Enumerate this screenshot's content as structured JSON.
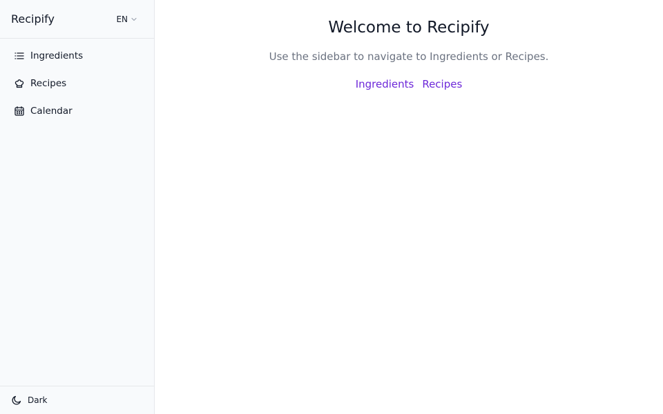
{
  "app": {
    "name": "Recipify"
  },
  "language": {
    "selected": "EN",
    "icon": "chevron-down-icon"
  },
  "sidebar": {
    "items": [
      {
        "label": "Ingredients",
        "icon": "list-icon"
      },
      {
        "label": "Recipes",
        "icon": "chef-hat-icon"
      },
      {
        "label": "Calendar",
        "icon": "calendar-icon"
      }
    ],
    "footer": {
      "theme_label": "Dark",
      "icon": "moon-icon"
    }
  },
  "main": {
    "title": "Welcome to Recipify",
    "subtitle": "Use the sidebar to navigate to Ingredients or Recipes.",
    "links": [
      {
        "label": "Ingredients"
      },
      {
        "label": "Recipes"
      }
    ]
  },
  "colors": {
    "accent": "#6d28d9",
    "sidebar_bg": "#f8fafc",
    "border": "#e5e7eb",
    "muted_text": "#6b7280"
  }
}
